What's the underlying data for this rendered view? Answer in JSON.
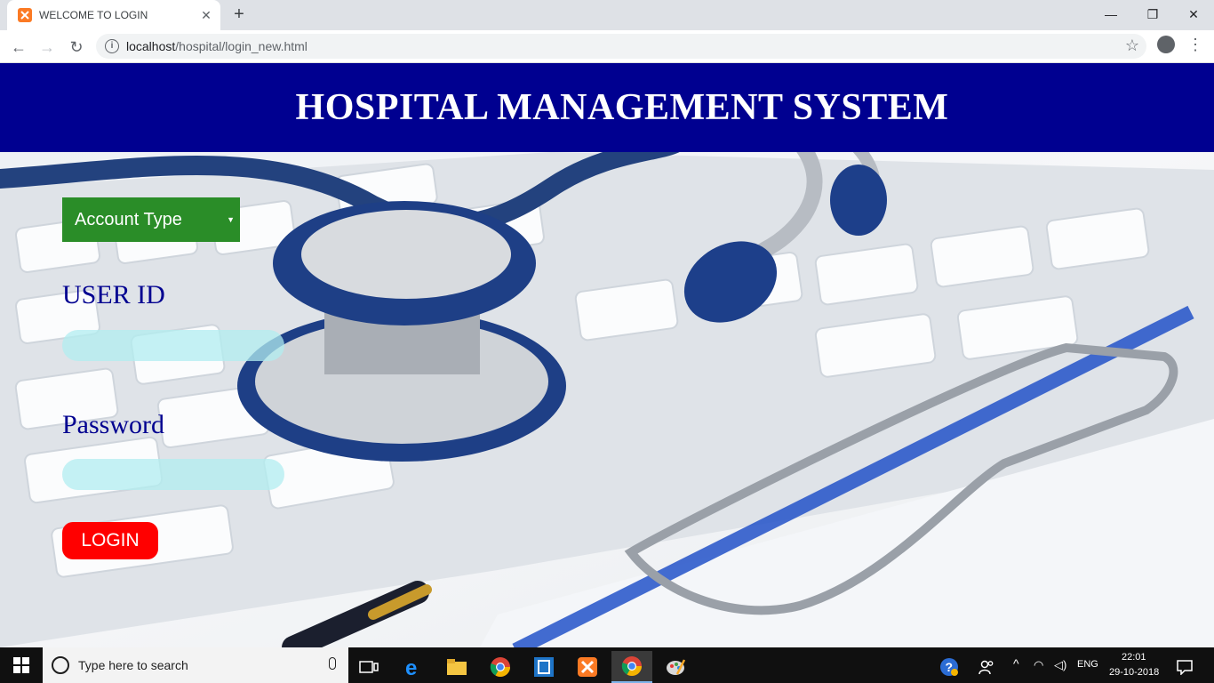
{
  "browser": {
    "tab_title": "WELCOME TO LOGIN",
    "tab_favicon": "xampp-icon",
    "url_host": "localhost",
    "url_path": "/hospital/login_new.html"
  },
  "page": {
    "header_title": "HOSPITAL MANAGEMENT SYSTEM",
    "account_type_label": "Account Type",
    "user_id_label": "USER ID",
    "password_label": "Password",
    "login_label": "LOGIN"
  },
  "taskbar": {
    "search_placeholder": "Type here to search",
    "language": "ENG",
    "time": "22:01",
    "date": "29-10-2018"
  },
  "colors": {
    "header_bg": "#000090",
    "label_color": "#000090",
    "select_bg": "#2a8d28",
    "login_bg": "#ff0000",
    "input_bg": "#b2eef0"
  }
}
